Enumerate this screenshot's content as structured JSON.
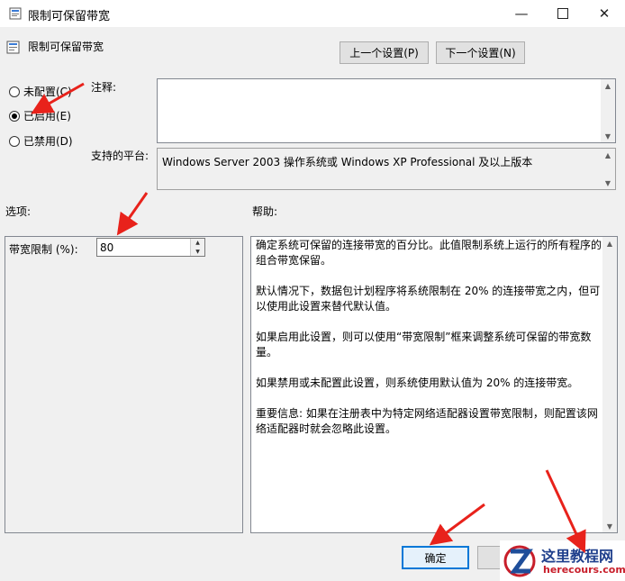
{
  "window": {
    "title": "限制可保留带宽",
    "controls": [
      "minimize",
      "maximize",
      "close"
    ]
  },
  "header": {
    "policy_name": "限制可保留带宽",
    "prev_button": "上一个设置(P)",
    "next_button": "下一个设置(N)"
  },
  "state_options": [
    {
      "label": "未配置(C)",
      "selected": false
    },
    {
      "label": "已启用(E)",
      "selected": true
    },
    {
      "label": "已禁用(D)",
      "selected": false
    }
  ],
  "comment": {
    "label": "注释:",
    "value": ""
  },
  "platform": {
    "label": "支持的平台:",
    "value": "Windows Server 2003 操作系统或 Windows XP Professional 及以上版本"
  },
  "options_section": {
    "label": "选项:",
    "bandwidth_label": "带宽限制 (%):",
    "bandwidth_value": "80"
  },
  "help_section": {
    "label": "帮助:",
    "paragraphs": [
      "确定系统可保留的连接带宽的百分比。此值限制系统上运行的所有程序的组合带宽保留。",
      "默认情况下，数据包计划程序将系统限制在 20% 的连接带宽之内，但可以使用此设置来替代默认值。",
      "如果启用此设置，则可以使用“带宽限制”框来调整系统可保留的带宽数量。",
      "如果禁用或未配置此设置，则系统使用默认值为 20% 的连接带宽。",
      "重要信息: 如果在注册表中为特定网络适配器设置带宽限制，则配置该网络适配器时就会忽略此设置。"
    ]
  },
  "footer": {
    "ok_button": "确定"
  },
  "watermark": {
    "name": "这里教程网",
    "url": "herecours.com"
  },
  "colors": {
    "annotation_red": "#e8221b",
    "selection_blue": "#0078d7"
  }
}
